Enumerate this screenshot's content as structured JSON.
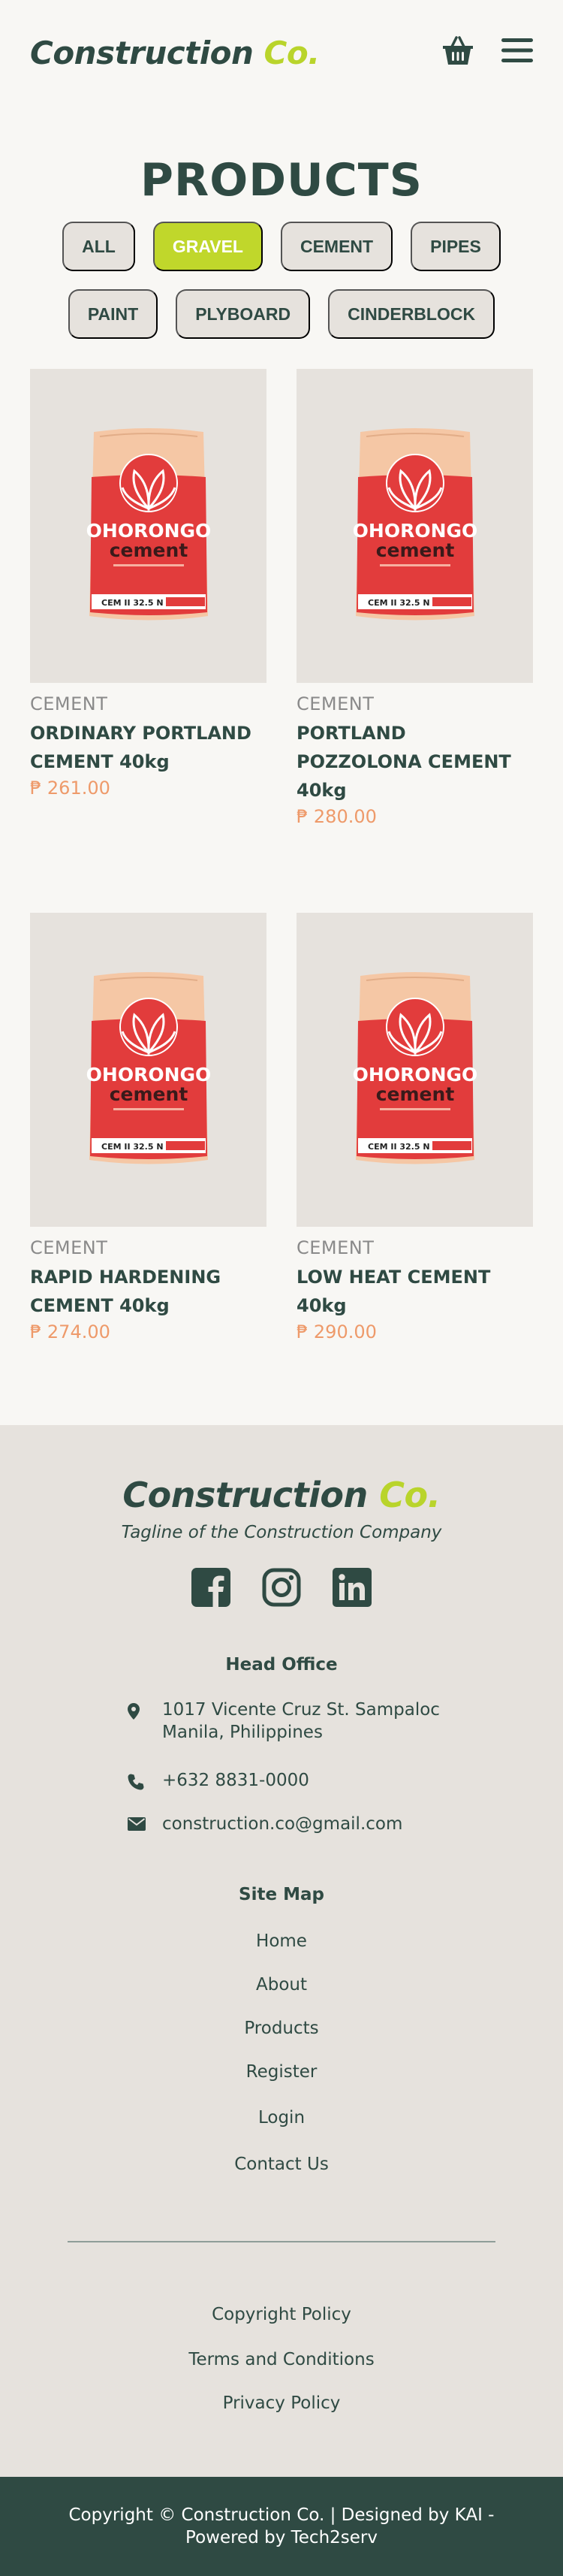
{
  "header": {
    "logo_main": "Construction",
    "logo_accent": "Co.",
    "cart_icon": "basket-icon",
    "menu_icon": "hamburger-menu-icon"
  },
  "products_title": "PRODUCTS",
  "filters": [
    "ALL",
    "GRAVEL",
    "CEMENT",
    "PIPES",
    "PAINT",
    "PLYBOARD",
    "CINDERBLOCK"
  ],
  "active_filter": "GRAVEL",
  "products": [
    {
      "category": "CEMENT",
      "name": "ORDINARY PORTLAND CEMENT 40kg",
      "price": "₱ 261.00"
    },
    {
      "category": "CEMENT",
      "name": "PORTLAND POZZOLONA CEMENT  40kg",
      "price": "₱ 280.00"
    },
    {
      "category": "CEMENT",
      "name": "RAPID HARDENING CEMENT 40kg",
      "price": "₱ 274.00"
    },
    {
      "category": "CEMENT",
      "name": "LOW HEAT CEMENT 40kg",
      "price": "₱ 290.00"
    }
  ],
  "bag": {
    "brand": "OHORONGO",
    "product": "cement",
    "spec": "CEM II 32.5 N"
  },
  "footer": {
    "logo_main": "Construction",
    "logo_accent": "Co.",
    "tagline": "Tagline of the Construction Company",
    "social_icons": [
      "facebook-icon",
      "instagram-icon",
      "linkedin-icon"
    ],
    "head_office_title": "Head Office",
    "address_line1": "1017 Vicente Cruz St. Sampaloc",
    "address_line2": "Manila, Philippines",
    "phone": "+632 8831-0000",
    "email": "construction.co@gmail.com",
    "sitemap_title": "Site Map",
    "sitemap_links": [
      "Home",
      "About",
      "Products",
      "Register",
      "Login",
      "Contact Us"
    ],
    "policy_links": [
      "Copyright Policy",
      "Terms and Conditions",
      "Privacy Policy"
    ],
    "copyright_line1": "Copyright © Construction Co.  | Designed by KAI -",
    "copyright_line2": "Powered by Tech2serv"
  },
  "colors": {
    "primary": "#2f4a43",
    "accent": "#c0d72b",
    "price": "#ee9a6a",
    "card_bg": "#e6e2dd",
    "bag_red": "#e23c3c",
    "bag_paper": "#f5c7a5"
  }
}
